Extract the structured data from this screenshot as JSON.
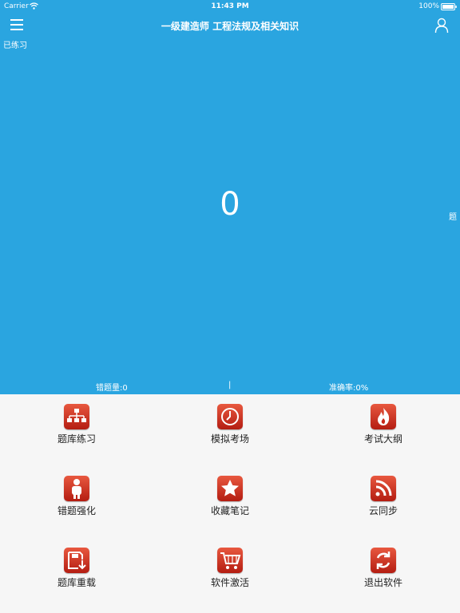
{
  "status": {
    "carrier": "Carrier",
    "time": "11:43 PM",
    "battery": "100%"
  },
  "nav": {
    "title": "一级建造师 工程法规及相关知识"
  },
  "summary": {
    "practiced_label": "已练习",
    "count": "0",
    "unit": "题",
    "wrong": "错题量:0",
    "separator": "|",
    "accuracy": "准确率:0%"
  },
  "colors": {
    "header_bg": "#2aa5e0",
    "icon_red": "#c8281a",
    "grid_bg": "#f6f6f6"
  },
  "menu": [
    {
      "label": "题库练习",
      "icon": "hierarchy-icon"
    },
    {
      "label": "模拟考场",
      "icon": "clock-icon"
    },
    {
      "label": "考试大纲",
      "icon": "flame-icon"
    },
    {
      "label": "错题强化",
      "icon": "person-icon"
    },
    {
      "label": "收藏笔记",
      "icon": "star-icon"
    },
    {
      "label": "云同步",
      "icon": "rss-icon"
    },
    {
      "label": "题库重载",
      "icon": "save-download-icon"
    },
    {
      "label": "软件激活",
      "icon": "cart-icon"
    },
    {
      "label": "退出软件",
      "icon": "refresh-icon"
    }
  ]
}
